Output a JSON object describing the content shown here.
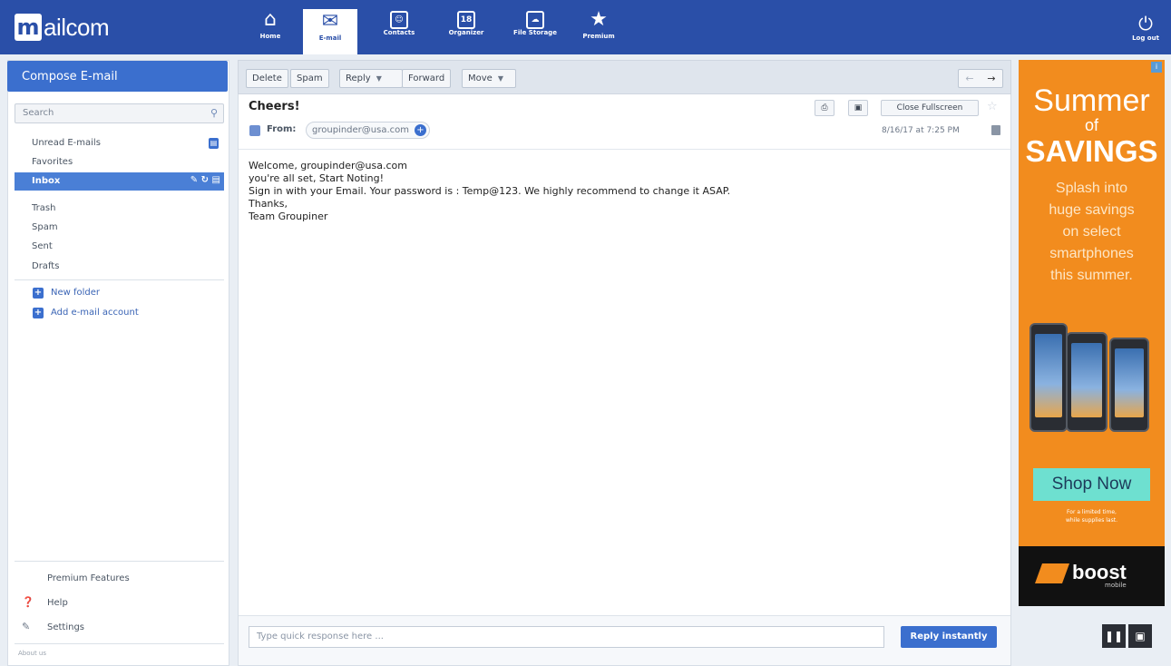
{
  "app": {
    "logo_m": "m",
    "logo_text": "ailcom"
  },
  "nav": {
    "home": "Home",
    "email": "E-mail",
    "contacts": "Contacts",
    "organizer": "Organizer",
    "organizer_date": "18",
    "file_storage": "File Storage",
    "premium": "Premium",
    "logout": "Log out"
  },
  "sidebar": {
    "compose": "Compose E-mail",
    "search_placeholder": "Search",
    "folders": {
      "unread": "Unread E-mails",
      "favorites": "Favorites",
      "inbox": "Inbox",
      "trash": "Trash",
      "spam": "Spam",
      "sent": "Sent",
      "drafts": "Drafts"
    },
    "new_folder": "New folder",
    "add_account": "Add e-mail account",
    "premium_features": "Premium Features",
    "help": "Help",
    "settings": "Settings",
    "about": "About us"
  },
  "toolbar": {
    "delete": "Delete",
    "spam": "Spam",
    "reply": "Reply",
    "forward": "Forward",
    "move": "Move"
  },
  "message": {
    "subject": "Cheers!",
    "from_label": "From:",
    "from_address": "groupinder@usa.com",
    "close_fullscreen": "Close Fullscreen",
    "date": "8/16/17 at 7:25 PM",
    "body_lines": [
      "Welcome, groupinder@usa.com",
      "you're all set, Start Noting!",
      "Sign in with your Email. Your password is : Temp@123. We highly recommend to change it ASAP.",
      "Thanks,",
      "Team Groupiner"
    ]
  },
  "quick_reply": {
    "placeholder": "Type quick response here ...",
    "button": "Reply instantly"
  },
  "ad": {
    "line1": "Summer",
    "line2": "of",
    "line3": "SAVINGS",
    "copy": [
      "Splash into",
      "huge savings",
      "on select",
      "smartphones",
      "this summer."
    ],
    "cta": "Shop Now",
    "fine_print_1": "For a limited time,",
    "fine_print_2": "while supplies last.",
    "brand": "boost",
    "brand_sub": "mobile",
    "brand_color": "#f28c1e"
  },
  "colors": {
    "nav_bg": "#2a4fa8",
    "accent": "#3b6fce"
  }
}
